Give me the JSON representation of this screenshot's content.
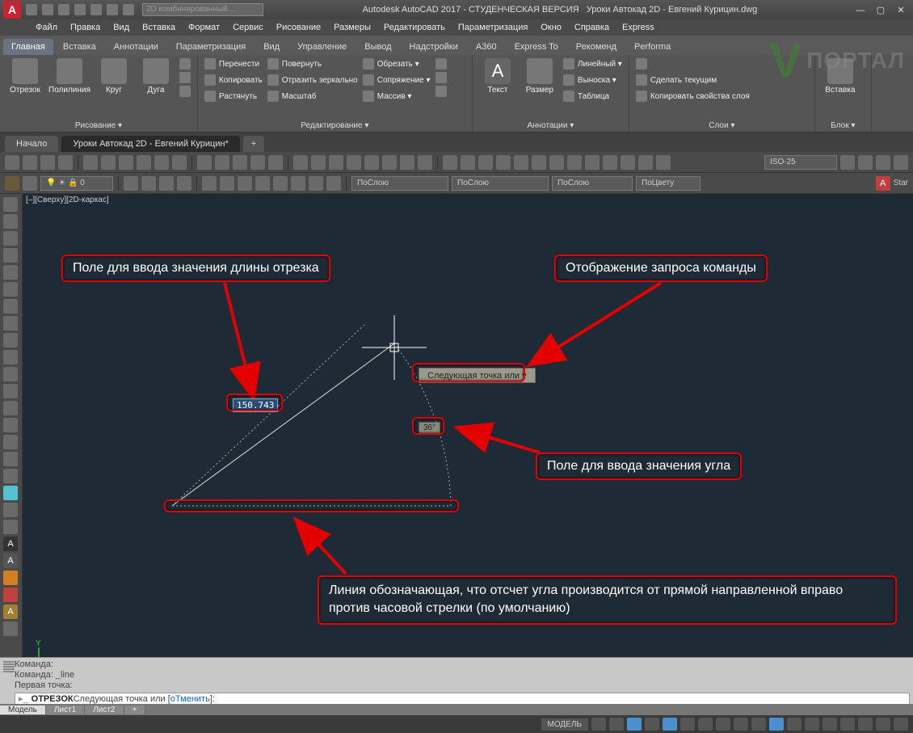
{
  "title": {
    "app": "Autodesk AutoCAD 2017 - СТУДЕНЧЕСКАЯ ВЕРСИЯ",
    "file": "Уроки Автокад 2D - Евгений Курицин.dwg",
    "search_placeholder": "2D комбинированный..."
  },
  "menu": [
    "Файл",
    "Правка",
    "Вид",
    "Вставка",
    "Формат",
    "Сервис",
    "Рисование",
    "Размеры",
    "Редактировать",
    "Параметризация",
    "Окно",
    "Справка",
    "Express"
  ],
  "ribbon_tabs": [
    "Главная",
    "Вставка",
    "Аннотации",
    "Параметризация",
    "Вид",
    "Управление",
    "Вывод",
    "Надстройки",
    "A360",
    "Express To",
    "Рекоменд",
    "Performa"
  ],
  "ribbon": {
    "draw": {
      "label": "Рисование ▾",
      "big": [
        {
          "n": "Отрезок"
        },
        {
          "n": "Полилиния"
        },
        {
          "n": "Круг"
        },
        {
          "n": "Дуга"
        }
      ]
    },
    "modify": {
      "label": "Редактирование ▾",
      "rows": [
        [
          "Перенести",
          "Повернуть",
          "Обрезать ▾"
        ],
        [
          "Копировать",
          "Отразить зеркально",
          "Сопряжение ▾"
        ],
        [
          "Растянуть",
          "Масштаб",
          "Массив ▾"
        ]
      ]
    },
    "annot": {
      "label": "Аннотации ▾",
      "big": [
        {
          "n": "Текст"
        },
        {
          "n": "Размер"
        }
      ],
      "rows": [
        [
          "Линейный ▾"
        ],
        [
          "Выноска ▾"
        ],
        [
          "Таблица"
        ]
      ]
    },
    "layers": {
      "label": "Слои ▾",
      "rows": [
        [
          "Сделать текущим"
        ],
        [
          "Копировать свойства слоя"
        ]
      ]
    },
    "block": {
      "label": "Блок ▾",
      "big": [
        {
          "n": "Вставка"
        }
      ]
    }
  },
  "doc_tabs": {
    "start": "Начало",
    "active": "Уроки Автокад 2D - Евгений Курицин*",
    "add": "+"
  },
  "toolbar2": {
    "combo1": "ПоСлою",
    "combo2": "ПоСлою",
    "combo3": "ПоСлою",
    "combo4": "ПоЦвету",
    "dimstyle": "ISO-25",
    "layer": "0"
  },
  "viewport_label": "[–][Сверху][2D-каркас]",
  "callouts": {
    "c1": "Поле для ввода значения длины отрезка",
    "c2": "Отображение запроса команды",
    "c3": "Поле для ввода значения угла",
    "c4": "Линия обозначающая, что отсчет угла производится от прямой направленной вправо против часовой стрелки (по умолчанию)"
  },
  "dyn": {
    "length": "150.743",
    "prompt": "Следующая точка или",
    "angle": "36°"
  },
  "command": {
    "l1": "Команда:",
    "l2": "Команда: _line",
    "l3": "Первая точка:",
    "prompt_cmd": "ОТРЕЗОК",
    "prompt_rest": " Следующая точка или [",
    "opt": "оТменить",
    "end": "]:"
  },
  "model_tabs": [
    "Модель",
    "Лист1",
    "Лист2"
  ],
  "status": {
    "model": "МОДЕЛЬ"
  },
  "watermark": "ПОРТАЛ"
}
